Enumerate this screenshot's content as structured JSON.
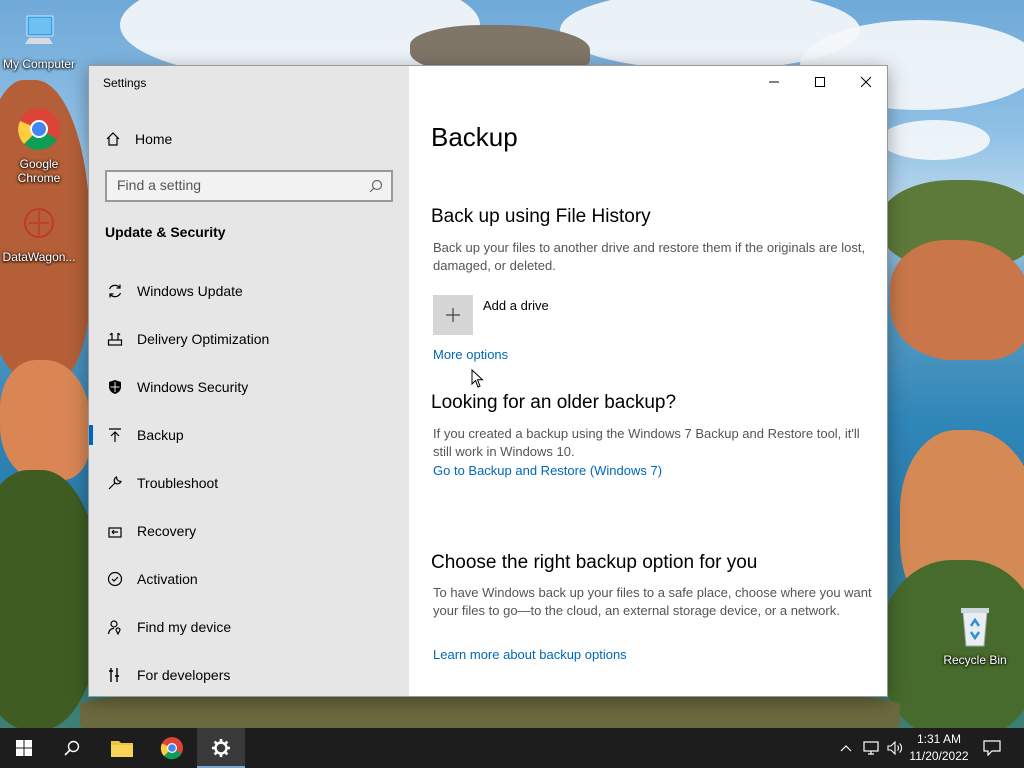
{
  "desktop": {
    "icons": [
      {
        "label": "My Computer"
      },
      {
        "label": "Google Chrome"
      },
      {
        "label": "DataWagon..."
      },
      {
        "label": "Recycle Bin"
      }
    ]
  },
  "window": {
    "title": "Settings",
    "controls": {
      "minimize": "minimize-icon",
      "maximize": "maximize-icon",
      "close": "close-icon"
    }
  },
  "sidebar": {
    "home_label": "Home",
    "search_placeholder": "Find a setting",
    "section_header": "Update & Security",
    "items": [
      {
        "label": "Windows Update",
        "icon": "sync-icon"
      },
      {
        "label": "Delivery Optimization",
        "icon": "delivery-icon"
      },
      {
        "label": "Windows Security",
        "icon": "shield-icon"
      },
      {
        "label": "Backup",
        "icon": "backup-arrow-icon",
        "active": true
      },
      {
        "label": "Troubleshoot",
        "icon": "wrench-icon"
      },
      {
        "label": "Recovery",
        "icon": "recovery-icon"
      },
      {
        "label": "Activation",
        "icon": "check-circle-icon"
      },
      {
        "label": "Find my device",
        "icon": "person-location-icon"
      },
      {
        "label": "For developers",
        "icon": "developer-tools-icon"
      }
    ]
  },
  "main": {
    "title": "Backup",
    "file_history": {
      "heading": "Back up using File History",
      "description": "Back up your files to another drive and restore them if the originals are lost, damaged, or deleted.",
      "add_drive_label": "Add a drive",
      "more_options_link": "More options"
    },
    "older_backup": {
      "heading": "Looking for an older backup?",
      "description": "If you created a backup using the Windows 7 Backup and Restore tool, it'll still work in Windows 10.",
      "link": "Go to Backup and Restore (Windows 7)"
    },
    "choose_option": {
      "heading": "Choose the right backup option for you",
      "description": "To have Windows back up your files to a safe place, choose where you want your files to go—to the cloud, an external storage device, or a network.",
      "link": "Learn more about backup options"
    }
  },
  "taskbar": {
    "time": "1:31 AM",
    "date": "11/20/2022"
  },
  "colors": {
    "accent": "#0067c0",
    "link": "#0067b8",
    "sidebar_bg": "#e6e6e6",
    "taskbar_bg": "#1d1d1d"
  }
}
